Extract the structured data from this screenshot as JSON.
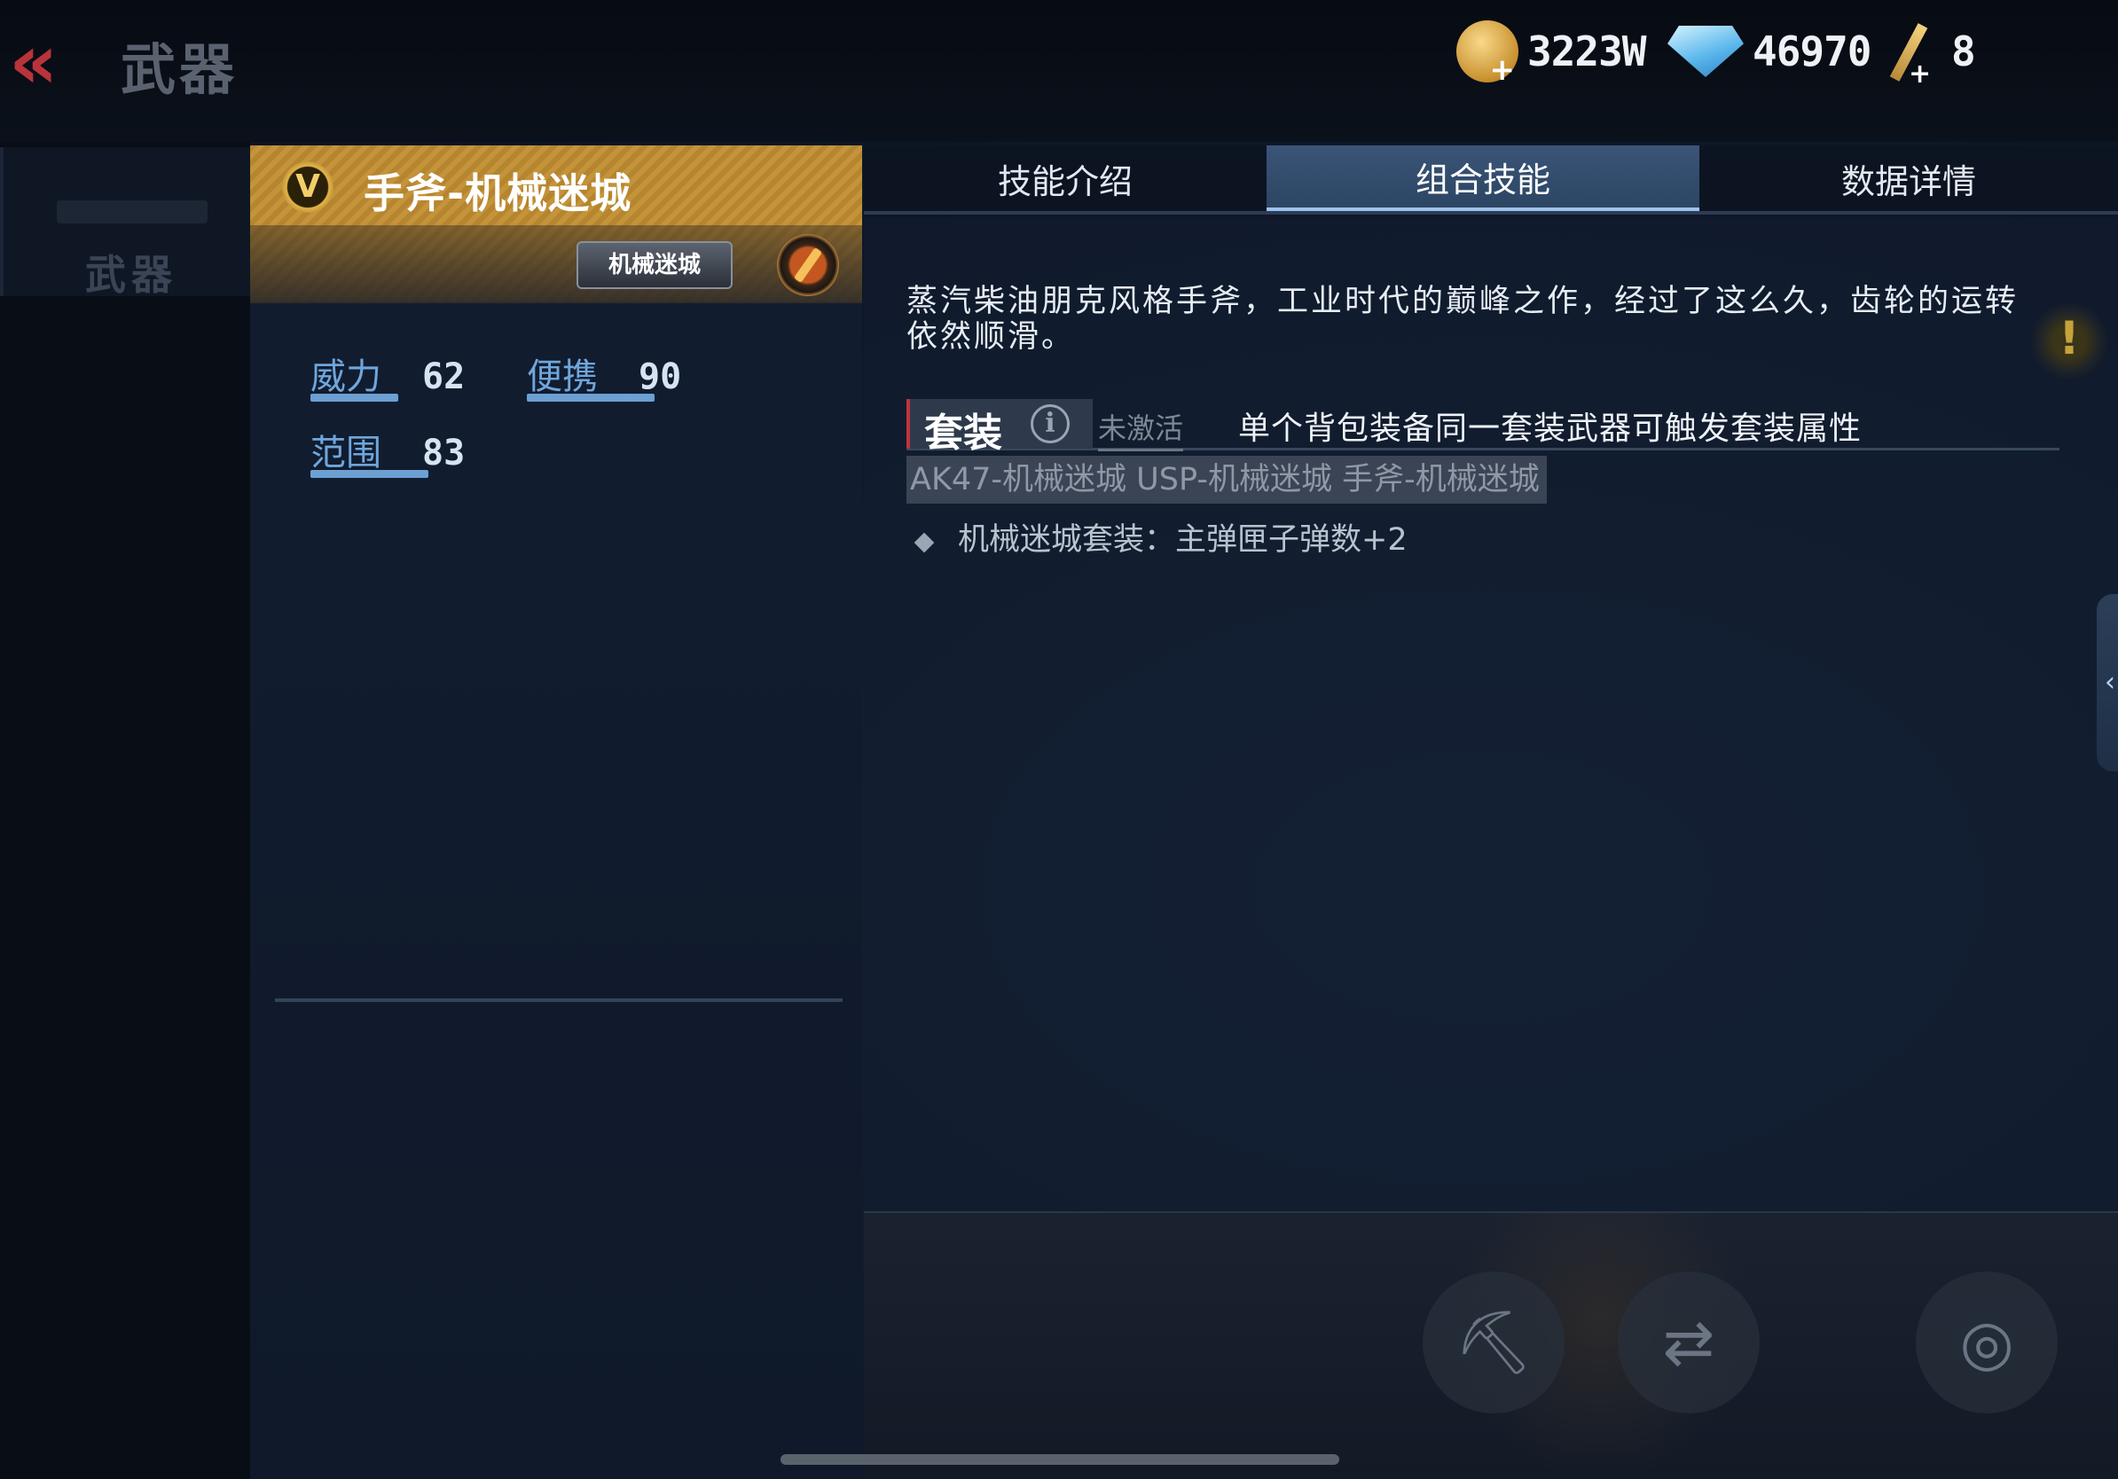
{
  "header": {
    "back_label": "«",
    "title": "武器",
    "currency": {
      "gold": "3223W",
      "diamond": "46970",
      "key": "8"
    }
  },
  "sidebar": {
    "items": [
      {
        "label": "武器",
        "icon": "rifle-icon"
      }
    ]
  },
  "weapon": {
    "rank_badge": "V",
    "name": "手斧-机械迷城",
    "series_tag": "机械迷城",
    "stats": [
      {
        "label": "威力",
        "value": "62",
        "fill": 0.62
      },
      {
        "label": "便携",
        "value": "90",
        "fill": 0.9
      },
      {
        "label": "范围",
        "value": "83",
        "fill": 0.83
      }
    ]
  },
  "tabs": [
    {
      "label": "技能介绍",
      "active": false
    },
    {
      "label": "组合技能",
      "active": true
    },
    {
      "label": "数据详情",
      "active": false
    }
  ],
  "detail": {
    "description": "蒸汽柴油朋克风格手斧，工业时代的巅峰之作，经过了这么久，齿轮的运转依然顺滑。",
    "set": {
      "label": "套装",
      "info_icon": "i",
      "status": "未激活",
      "rule": "单个背包装备同一套装武器可触发套装属性",
      "items": "AK47-机械迷城 USP-机械迷城 手斧-机械迷城",
      "bonus": "机械迷城套装：主弹匣子弹数+2"
    }
  },
  "icons": {
    "back": "back-arrow-icon",
    "gold": "gold-coin-icon",
    "diamond": "diamond-icon",
    "key": "key-icon",
    "skill": "skill-badge-icon",
    "alert": "exclamation-icon",
    "side_arrow": "chevron-left-icon"
  },
  "colors": {
    "accent_gold": "#c4933a",
    "tab_active": "#3b5578",
    "stat_label": "#6fa6dc",
    "back_red": "#b8343a"
  }
}
